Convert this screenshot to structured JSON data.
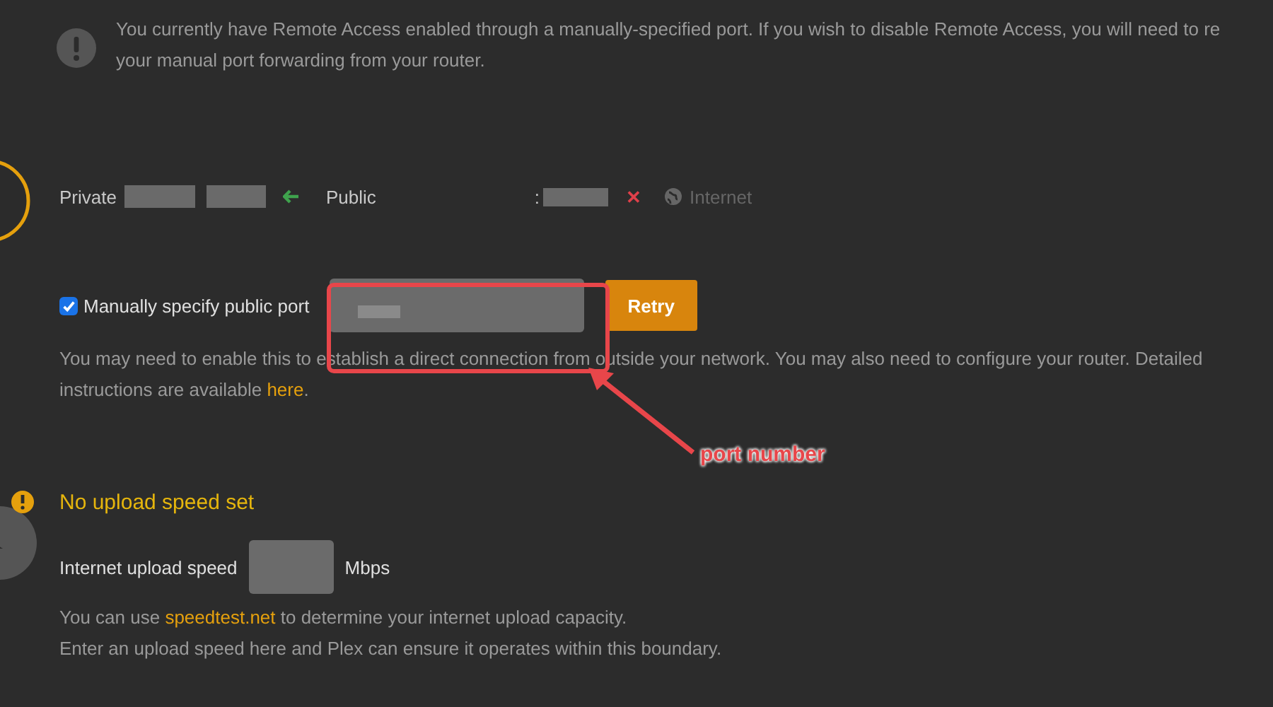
{
  "notice": {
    "text": "You currently have Remote Access enabled through a manually-specified port. If you wish to disable Remote Access, you will need to re\nyour manual port forwarding from your router."
  },
  "connection": {
    "private_label": "Private",
    "public_label": "Public",
    "port_separator": ":",
    "status_mark": "✕",
    "internet_label": "Internet"
  },
  "manual_port": {
    "label": "Manually specify public port",
    "checked": true,
    "button": "Retry",
    "help": "You may need to enable this to establish a direct connection from outside your network. You may also need to configure your router. Detailed instructions are available ",
    "help_link": "here",
    "help_end": "."
  },
  "upload": {
    "warning": "No upload speed set",
    "label": "Internet upload speed",
    "unit": "Mbps",
    "line1_start": "You can use ",
    "line1_link": "speedtest.net",
    "line1_end": " to determine your internet upload capacity.",
    "line2": "Enter an upload speed here and Plex can ensure it operates within this boundary."
  },
  "annotation": {
    "label": "port number"
  }
}
